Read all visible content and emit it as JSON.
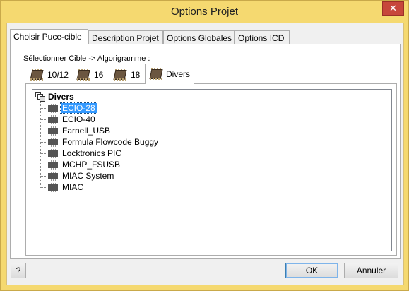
{
  "window": {
    "title": "Options Projet",
    "close_glyph": "✕"
  },
  "tabs": [
    {
      "label": "Choisir Puce-cible",
      "active": true
    },
    {
      "label": "Description Projet",
      "active": false
    },
    {
      "label": "Options Globales",
      "active": false
    },
    {
      "label": "Options ICD",
      "active": false
    }
  ],
  "section_label": "Sélectionner Cible -> Algorigramme :",
  "subtabs": [
    {
      "label": "10/12",
      "icon": "chip-icon"
    },
    {
      "label": "16",
      "icon": "chip-icon"
    },
    {
      "label": "18",
      "icon": "chip-icon"
    },
    {
      "label": "Divers",
      "icon": "chip-icon",
      "active": true
    }
  ],
  "tree": {
    "root": "Divers",
    "root_icon": "windows-stack-icon",
    "items": [
      {
        "label": "ECIO-28",
        "selected": true
      },
      {
        "label": "ECIO-40"
      },
      {
        "label": "Farnell_USB"
      },
      {
        "label": "Formula Flowcode Buggy"
      },
      {
        "label": "Locktronics PIC"
      },
      {
        "label": "MCHP_FSUSB"
      },
      {
        "label": "MIAC System"
      },
      {
        "label": "MIAC"
      }
    ]
  },
  "buttons": {
    "help": "?",
    "ok": "OK",
    "cancel": "Annuler"
  },
  "colors": {
    "frame": "#f5d970",
    "selection": "#3399ff",
    "close": "#c7463b"
  }
}
